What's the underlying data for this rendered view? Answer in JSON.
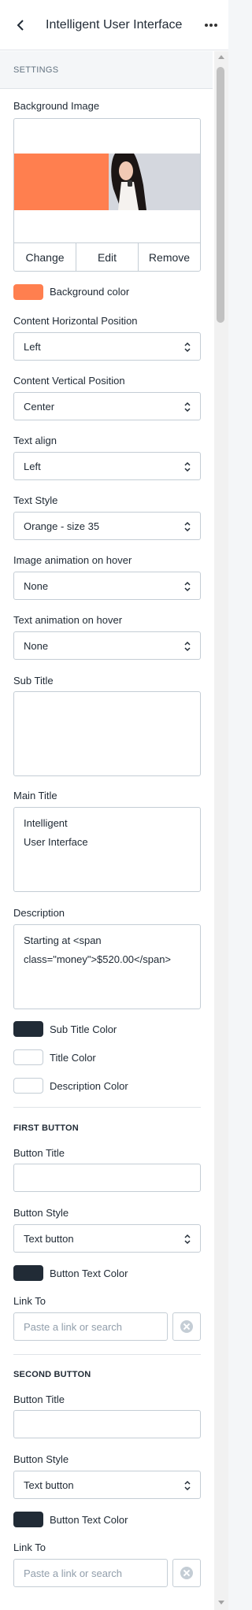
{
  "header": {
    "title": "Intelligent User Interface",
    "back_icon": "chevron-left-icon",
    "more_icon": "more-horizontal-icon"
  },
  "section": {
    "label": "SETTINGS"
  },
  "background_image": {
    "label": "Background Image",
    "buttons": {
      "change": "Change",
      "edit": "Edit",
      "remove": "Remove"
    }
  },
  "background_color": {
    "label": "Background color",
    "value": "#ff7f4f"
  },
  "content_horizontal": {
    "label": "Content Horizontal Position",
    "value": "Left"
  },
  "content_vertical": {
    "label": "Content Vertical Position",
    "value": "Center"
  },
  "text_align": {
    "label": "Text align",
    "value": "Left"
  },
  "text_style": {
    "label": "Text Style",
    "value": "Orange - size 35"
  },
  "image_animation": {
    "label": "Image animation on hover",
    "value": "None"
  },
  "text_animation": {
    "label": "Text animation on hover",
    "value": "None"
  },
  "sub_title": {
    "label": "Sub Title",
    "value": ""
  },
  "main_title": {
    "label": "Main Title",
    "value": "Intelligent\nUser Interface"
  },
  "description": {
    "label": "Description",
    "value": "Starting at <span\nclass=\"money\">$520.00</span>"
  },
  "colors": {
    "sub_title": {
      "label": "Sub Title Color",
      "value": "#212b36"
    },
    "title": {
      "label": "Title Color",
      "value": "#ffffff"
    },
    "description": {
      "label": "Description Color",
      "value": "#ffffff"
    }
  },
  "first_button": {
    "heading": "FIRST BUTTON",
    "title_label": "Button Title",
    "title_value": "",
    "style_label": "Button Style",
    "style_value": "Text button",
    "text_color_label": "Button Text Color",
    "text_color": "#212b36",
    "link_label": "Link To",
    "link_placeholder": "Paste a link or search"
  },
  "second_button": {
    "heading": "SECOND BUTTON",
    "title_label": "Button Title",
    "title_value": "",
    "style_label": "Button Style",
    "style_value": "Text button",
    "text_color_label": "Button Text Color",
    "text_color": "#212b36",
    "link_label": "Link To",
    "link_placeholder": "Paste a link or search"
  }
}
